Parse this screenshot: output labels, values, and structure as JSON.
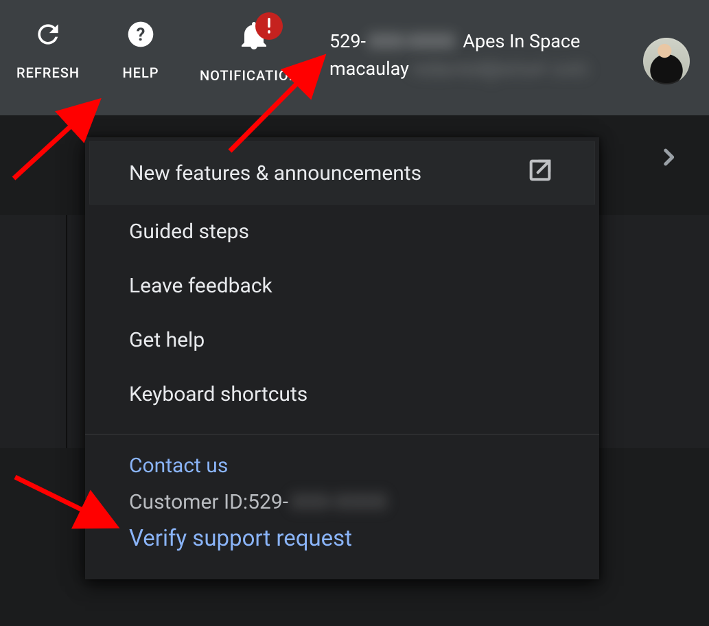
{
  "topbar": {
    "refresh_label": "REFRESH",
    "help_label": "HELP",
    "notifications_label": "NOTIFICATIONS"
  },
  "account": {
    "id_prefix": "529-",
    "id_hidden": "XXX-XXXX",
    "name": "Apes In Space",
    "user_prefix": "macaulay",
    "user_hidden": "redacted@email.com"
  },
  "help_menu": {
    "items": [
      {
        "label": "New features & announcements",
        "external": true
      },
      {
        "label": "Guided steps",
        "external": false
      },
      {
        "label": "Leave feedback",
        "external": false
      },
      {
        "label": "Get help",
        "external": false
      },
      {
        "label": "Keyboard shortcuts",
        "external": false
      }
    ],
    "contact_us": "Contact us",
    "customer_id_label": "Customer ID: ",
    "customer_id_prefix": "529-",
    "customer_id_hidden": "XXX-XXXX",
    "verify": "Verify support request"
  }
}
